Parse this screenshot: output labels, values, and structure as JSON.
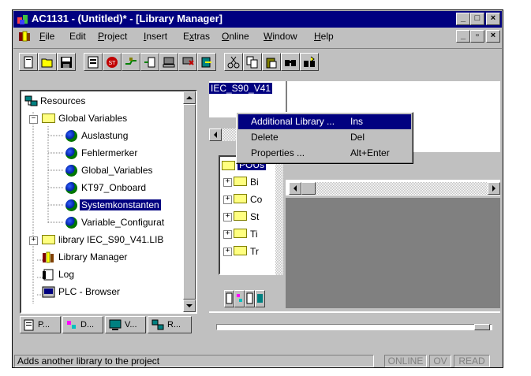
{
  "window": {
    "title": "AC1131 - (Untitled)* - [Library Manager]",
    "caption_buttons": [
      "_",
      "□",
      "×"
    ],
    "mdi_buttons": [
      "_",
      "▫",
      "×"
    ]
  },
  "menu": {
    "items": [
      {
        "pre": "",
        "u": "F",
        "post": "ile"
      },
      {
        "pre": "",
        "u": "",
        "post": "Edit"
      },
      {
        "pre": "",
        "u": "P",
        "post": "roject"
      },
      {
        "pre": "",
        "u": "I",
        "post": "nsert"
      },
      {
        "pre": "E",
        "u": "x",
        "post": "tras"
      },
      {
        "pre": "",
        "u": "O",
        "post": "nline"
      },
      {
        "pre": "",
        "u": "W",
        "post": "indow"
      },
      {
        "pre": "",
        "u": "H",
        "post": "elp"
      }
    ]
  },
  "tree": {
    "items": [
      {
        "label": "Resources"
      },
      {
        "label": "Global Variables"
      },
      {
        "label": "Auslastung"
      },
      {
        "label": "Fehlermerker"
      },
      {
        "label": "Global_Variables"
      },
      {
        "label": "KT97_Onboard"
      },
      {
        "label": "Systemkonstanten"
      },
      {
        "label": "Variable_Configurat"
      },
      {
        "label": "library IEC_S90_V41.LIB"
      },
      {
        "label": "Library Manager"
      },
      {
        "label": "Log"
      },
      {
        "label": "PLC - Browser"
      }
    ]
  },
  "left_tabs": [
    "P...",
    "D...",
    "V...",
    "R..."
  ],
  "library_list": {
    "selected_entry": "IEC_S90_V41"
  },
  "pou_tree": {
    "header": "POUs",
    "items": [
      "Bi",
      "Co",
      "St",
      "Ti",
      "Tr"
    ]
  },
  "context_menu": {
    "items": [
      {
        "label": "Additional Library ...",
        "u": "A",
        "shortcut": "Ins"
      },
      {
        "label": "Delete",
        "u": "D",
        "shortcut": "Del"
      },
      {
        "label": "Properties ...",
        "u": "P",
        "shortcut": "Alt+Enter"
      }
    ]
  },
  "status": {
    "message": "Adds another library to the project",
    "online": "ONLINE",
    "ov": "OV",
    "read": "READ"
  },
  "colors": {
    "face": "#c0c0c0",
    "title_bar": "#000080",
    "selection": "#000080",
    "workspace": "#808080"
  }
}
